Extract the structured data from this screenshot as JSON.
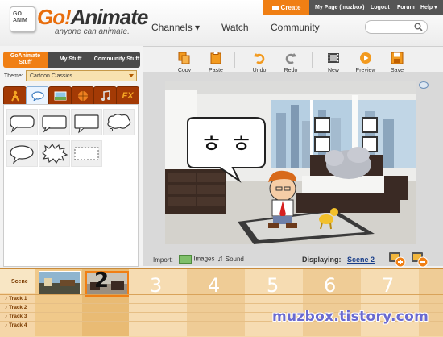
{
  "brand": {
    "logo_box_text": "GO ANIM",
    "logo_go": "Go!",
    "logo_name": "Animate",
    "tagline": "anyone can animate."
  },
  "topbar": {
    "create": "Create",
    "my_page": "My Page (muzbox)",
    "logout": "Logout",
    "forum": "Forum",
    "help": "Help ▾"
  },
  "nav": {
    "channels": "Channels ▾",
    "watch": "Watch",
    "community": "Community"
  },
  "left_tabs": {
    "goanimate_stuff": "GoAnimate Stuff",
    "my_stuff": "My Stuff",
    "community_stuff": "Community Stuff"
  },
  "theme": {
    "label": "Theme:",
    "selected": "Cartoon Classics"
  },
  "category_tabs": {
    "fx": "FX"
  },
  "toolbar": {
    "copy": "Copy",
    "paste": "Paste",
    "undo": "Undo",
    "redo": "Redo",
    "new": "New",
    "preview": "Preview",
    "save": "Save"
  },
  "stage": {
    "bubble_text": "ㅎ ㅎ"
  },
  "import_bar": {
    "import_label": "Import:",
    "images": "Images",
    "sound": "Sound",
    "displaying_label": "Displaying:",
    "scene": "Scene 2"
  },
  "timeline": {
    "scene_label": "Scene",
    "scene_numbers": [
      "2",
      "3",
      "4",
      "5",
      "6",
      "7"
    ],
    "tracks": [
      "Track 1",
      "Track 2",
      "Track 3",
      "Track 4"
    ]
  },
  "watermark": "muzbox.tistory.com",
  "colors": {
    "accent_orange": "#f07f14",
    "tab_brown": "#a33a05",
    "timeline_bg": "#f5d6a8"
  }
}
